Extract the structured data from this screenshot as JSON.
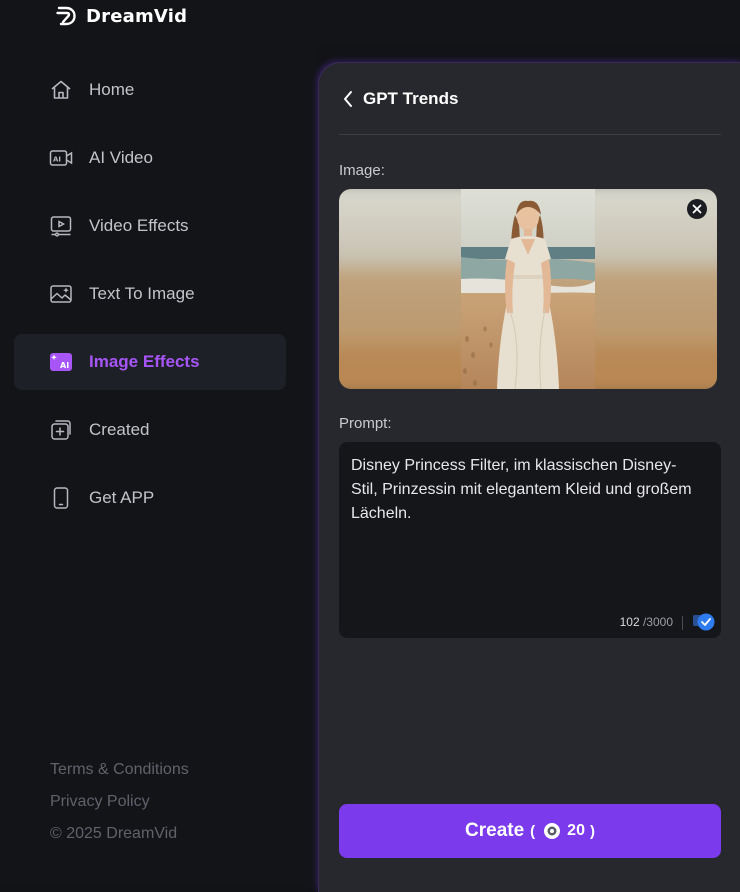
{
  "brand": {
    "name": "DreamVid",
    "accent": "#a855f7"
  },
  "sidebar": {
    "items": [
      {
        "label": "Home",
        "icon": "home-icon",
        "active": false
      },
      {
        "label": "AI Video",
        "icon": "ai-video-icon",
        "active": false
      },
      {
        "label": "Video Effects",
        "icon": "video-effects-icon",
        "active": false
      },
      {
        "label": "Text To Image",
        "icon": "text-to-image-icon",
        "active": false
      },
      {
        "label": "Image Effects",
        "icon": "image-effects-icon",
        "active": true
      },
      {
        "label": "Created",
        "icon": "created-icon",
        "active": false
      },
      {
        "label": "Get APP",
        "icon": "phone-icon",
        "active": false
      }
    ],
    "footer": {
      "terms": "Terms & Conditions",
      "privacy": "Privacy Policy",
      "copyright": "© 2025 DreamVid"
    }
  },
  "panel": {
    "title": "GPT Trends",
    "image_label": "Image:",
    "prompt_label": "Prompt:",
    "prompt_value": "Disney Princess Filter, im klassischen Disney-Stil, Prinzessin mit elegantem Kleid und großem Lächeln.",
    "char_count": "102",
    "char_max": "/3000",
    "create": {
      "label": "Create",
      "open_paren": "(",
      "credits": "20",
      "close_paren": ")",
      "color": "#7c3aed"
    }
  }
}
